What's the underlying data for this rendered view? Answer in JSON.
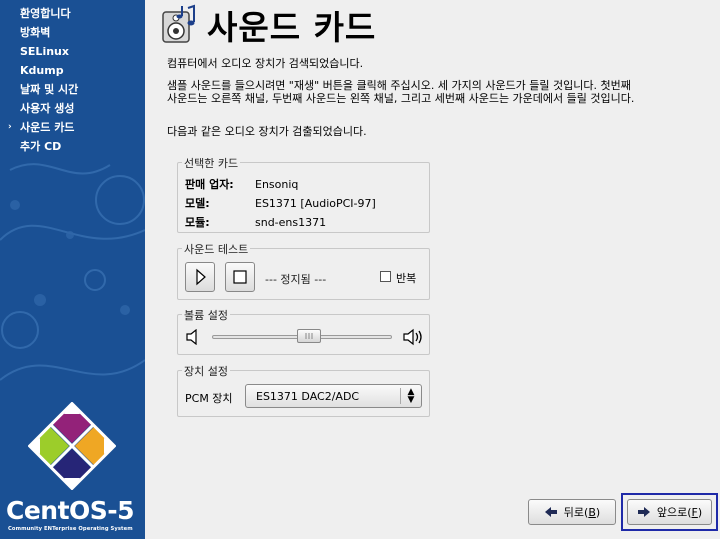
{
  "sidebar": {
    "items": [
      {
        "label": "환영합니다",
        "current": false
      },
      {
        "label": "방화벽",
        "current": false
      },
      {
        "label": "SELinux",
        "current": false
      },
      {
        "label": "Kdump",
        "current": false
      },
      {
        "label": "날짜 및 시간",
        "current": false
      },
      {
        "label": "사용자 생성",
        "current": false
      },
      {
        "label": "사운드 카드",
        "current": true
      },
      {
        "label": "추가 CD",
        "current": false
      }
    ],
    "current_marker": "›",
    "brand": "CentOS-5",
    "brand_tagline": "Community ENTerprise Operating System"
  },
  "page": {
    "title": "사운드 카드",
    "intro": "컴퓨터에서 오디오 장치가 검색되었습니다.",
    "instructions": "샘플 사운드를 들으시려면 \"재생\" 버튼을 클릭해 주십시오. 세 가지의 사운드가 들릴 것입니다. 첫번째 사운드는 오른쪽 채널, 두번째 사운드는 왼쪽 채널, 그리고 세번째 사운드는 가운데에서 들릴 것입니다.",
    "detected": "다음과 같은 오디오 장치가 검출되었습니다."
  },
  "selected_card": {
    "legend": "선택한 카드",
    "vendor_label": "판매 업자:",
    "vendor": "Ensoniq",
    "model_label": "모델:",
    "model": "ES1371 [AudioPCI-97]",
    "module_label": "모듈:",
    "module": "snd-ens1371"
  },
  "sound_test": {
    "legend": "사운드 테스트",
    "status": "--- 정지됨 ---",
    "repeat_label": "반복",
    "repeat_checked": false
  },
  "volume": {
    "legend": "볼륨 설정",
    "level": 0.55
  },
  "device": {
    "legend": "장치 설정",
    "pcm_label": "PCM 장치",
    "pcm_value": "ES1371 DAC2/ADC"
  },
  "buttons": {
    "back_label": "뒤로(",
    "back_key": "B",
    "back_close": ")",
    "next_label": "앞으로(",
    "next_key": "F",
    "next_close": ")"
  },
  "colors": {
    "sidebar_bg": "#1a5094",
    "focus_frame": "#1f2aa8"
  }
}
